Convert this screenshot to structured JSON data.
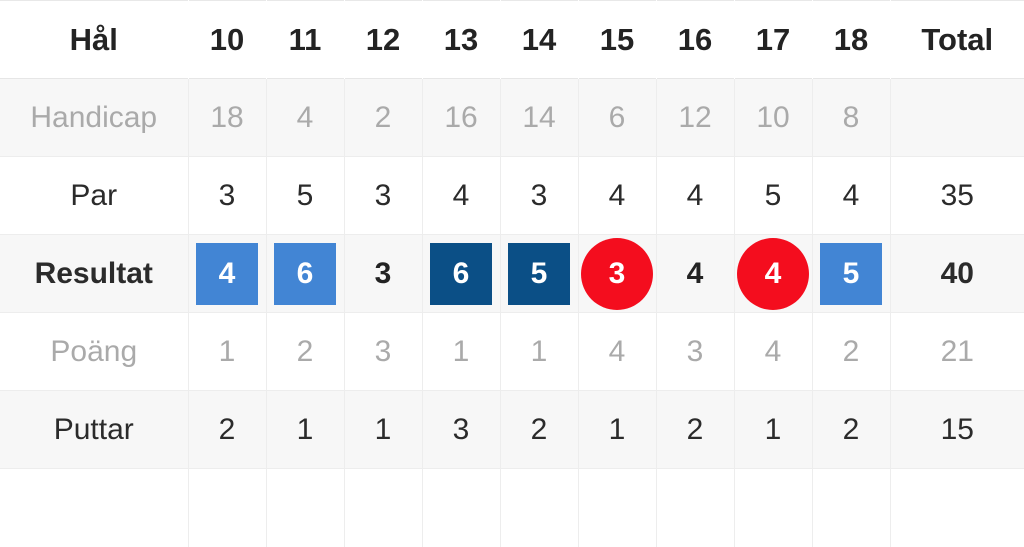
{
  "table": {
    "columns": {
      "label_header": "Hål",
      "holes": [
        "10",
        "11",
        "12",
        "13",
        "14",
        "15",
        "16",
        "17",
        "18"
      ],
      "total_header": "Total"
    },
    "rows": [
      {
        "label": "Handicap",
        "values": [
          "18",
          "4",
          "2",
          "16",
          "14",
          "6",
          "12",
          "10",
          "8"
        ],
        "total": ""
      },
      {
        "label": "Par",
        "values": [
          "3",
          "5",
          "3",
          "4",
          "3",
          "4",
          "4",
          "5",
          "4"
        ],
        "total": "35"
      },
      {
        "label": "Resultat",
        "values": [
          "4",
          "6",
          "3",
          "6",
          "5",
          "3",
          "4",
          "4",
          "5"
        ],
        "total": "40",
        "markers": [
          "sq-light",
          "sq-light",
          "plain",
          "sq-dark",
          "sq-dark",
          "circle-red",
          "plain",
          "circle-red",
          "sq-light"
        ]
      },
      {
        "label": "Poäng",
        "values": [
          "1",
          "2",
          "3",
          "1",
          "1",
          "4",
          "3",
          "4",
          "2"
        ],
        "total": "21"
      },
      {
        "label": "Puttar",
        "values": [
          "2",
          "1",
          "1",
          "3",
          "2",
          "1",
          "2",
          "1",
          "2"
        ],
        "total": "15"
      },
      {
        "label": "",
        "values": [
          "",
          "",
          "",
          "",
          "",
          "",
          "",
          "",
          ""
        ],
        "total": ""
      }
    ]
  },
  "colors": {
    "marker_light_blue": "#4285d4",
    "marker_dark_blue": "#0b4f86",
    "marker_red": "#f40d1e",
    "row_shaded": "#f7f7f7",
    "text_primary": "#2b2b2b",
    "text_muted": "#aaaaaa"
  }
}
